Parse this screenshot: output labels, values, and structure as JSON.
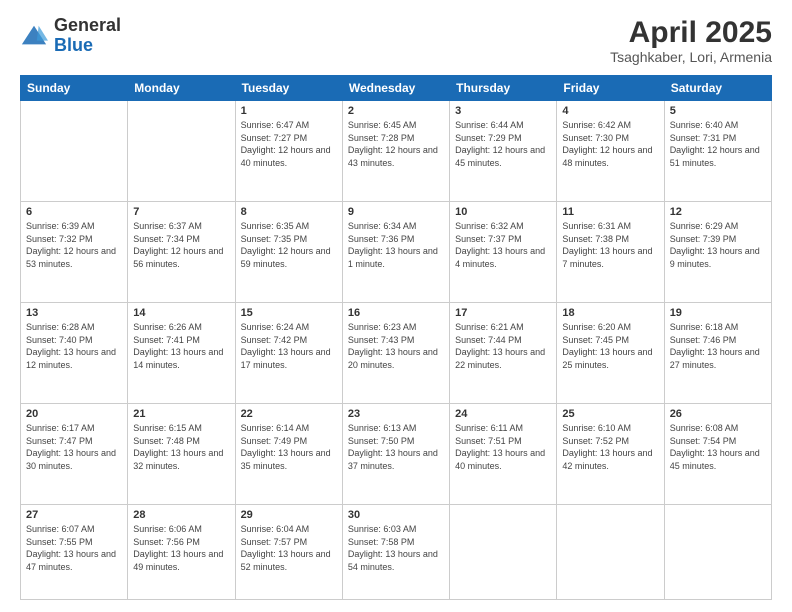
{
  "header": {
    "logo_general": "General",
    "logo_blue": "Blue",
    "month_title": "April 2025",
    "subtitle": "Tsaghkaber, Lori, Armenia"
  },
  "days_of_week": [
    "Sunday",
    "Monday",
    "Tuesday",
    "Wednesday",
    "Thursday",
    "Friday",
    "Saturday"
  ],
  "weeks": [
    [
      {
        "day": "",
        "info": ""
      },
      {
        "day": "",
        "info": ""
      },
      {
        "day": "1",
        "info": "Sunrise: 6:47 AM\nSunset: 7:27 PM\nDaylight: 12 hours and 40 minutes."
      },
      {
        "day": "2",
        "info": "Sunrise: 6:45 AM\nSunset: 7:28 PM\nDaylight: 12 hours and 43 minutes."
      },
      {
        "day": "3",
        "info": "Sunrise: 6:44 AM\nSunset: 7:29 PM\nDaylight: 12 hours and 45 minutes."
      },
      {
        "day": "4",
        "info": "Sunrise: 6:42 AM\nSunset: 7:30 PM\nDaylight: 12 hours and 48 minutes."
      },
      {
        "day": "5",
        "info": "Sunrise: 6:40 AM\nSunset: 7:31 PM\nDaylight: 12 hours and 51 minutes."
      }
    ],
    [
      {
        "day": "6",
        "info": "Sunrise: 6:39 AM\nSunset: 7:32 PM\nDaylight: 12 hours and 53 minutes."
      },
      {
        "day": "7",
        "info": "Sunrise: 6:37 AM\nSunset: 7:34 PM\nDaylight: 12 hours and 56 minutes."
      },
      {
        "day": "8",
        "info": "Sunrise: 6:35 AM\nSunset: 7:35 PM\nDaylight: 12 hours and 59 minutes."
      },
      {
        "day": "9",
        "info": "Sunrise: 6:34 AM\nSunset: 7:36 PM\nDaylight: 13 hours and 1 minute."
      },
      {
        "day": "10",
        "info": "Sunrise: 6:32 AM\nSunset: 7:37 PM\nDaylight: 13 hours and 4 minutes."
      },
      {
        "day": "11",
        "info": "Sunrise: 6:31 AM\nSunset: 7:38 PM\nDaylight: 13 hours and 7 minutes."
      },
      {
        "day": "12",
        "info": "Sunrise: 6:29 AM\nSunset: 7:39 PM\nDaylight: 13 hours and 9 minutes."
      }
    ],
    [
      {
        "day": "13",
        "info": "Sunrise: 6:28 AM\nSunset: 7:40 PM\nDaylight: 13 hours and 12 minutes."
      },
      {
        "day": "14",
        "info": "Sunrise: 6:26 AM\nSunset: 7:41 PM\nDaylight: 13 hours and 14 minutes."
      },
      {
        "day": "15",
        "info": "Sunrise: 6:24 AM\nSunset: 7:42 PM\nDaylight: 13 hours and 17 minutes."
      },
      {
        "day": "16",
        "info": "Sunrise: 6:23 AM\nSunset: 7:43 PM\nDaylight: 13 hours and 20 minutes."
      },
      {
        "day": "17",
        "info": "Sunrise: 6:21 AM\nSunset: 7:44 PM\nDaylight: 13 hours and 22 minutes."
      },
      {
        "day": "18",
        "info": "Sunrise: 6:20 AM\nSunset: 7:45 PM\nDaylight: 13 hours and 25 minutes."
      },
      {
        "day": "19",
        "info": "Sunrise: 6:18 AM\nSunset: 7:46 PM\nDaylight: 13 hours and 27 minutes."
      }
    ],
    [
      {
        "day": "20",
        "info": "Sunrise: 6:17 AM\nSunset: 7:47 PM\nDaylight: 13 hours and 30 minutes."
      },
      {
        "day": "21",
        "info": "Sunrise: 6:15 AM\nSunset: 7:48 PM\nDaylight: 13 hours and 32 minutes."
      },
      {
        "day": "22",
        "info": "Sunrise: 6:14 AM\nSunset: 7:49 PM\nDaylight: 13 hours and 35 minutes."
      },
      {
        "day": "23",
        "info": "Sunrise: 6:13 AM\nSunset: 7:50 PM\nDaylight: 13 hours and 37 minutes."
      },
      {
        "day": "24",
        "info": "Sunrise: 6:11 AM\nSunset: 7:51 PM\nDaylight: 13 hours and 40 minutes."
      },
      {
        "day": "25",
        "info": "Sunrise: 6:10 AM\nSunset: 7:52 PM\nDaylight: 13 hours and 42 minutes."
      },
      {
        "day": "26",
        "info": "Sunrise: 6:08 AM\nSunset: 7:54 PM\nDaylight: 13 hours and 45 minutes."
      }
    ],
    [
      {
        "day": "27",
        "info": "Sunrise: 6:07 AM\nSunset: 7:55 PM\nDaylight: 13 hours and 47 minutes."
      },
      {
        "day": "28",
        "info": "Sunrise: 6:06 AM\nSunset: 7:56 PM\nDaylight: 13 hours and 49 minutes."
      },
      {
        "day": "29",
        "info": "Sunrise: 6:04 AM\nSunset: 7:57 PM\nDaylight: 13 hours and 52 minutes."
      },
      {
        "day": "30",
        "info": "Sunrise: 6:03 AM\nSunset: 7:58 PM\nDaylight: 13 hours and 54 minutes."
      },
      {
        "day": "",
        "info": ""
      },
      {
        "day": "",
        "info": ""
      },
      {
        "day": "",
        "info": ""
      }
    ]
  ]
}
